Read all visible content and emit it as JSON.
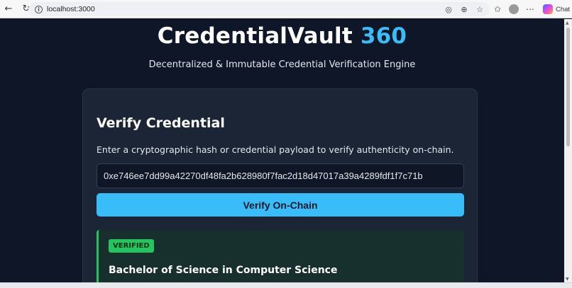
{
  "browser": {
    "url": "localhost:3000",
    "chat_label": "Chat",
    "icons": [
      "back-icon",
      "reload-icon",
      "info-icon",
      "translate-icon",
      "zoom-icon",
      "favorite-icon",
      "collections-icon",
      "profile-avatar",
      "more-icon",
      "copilot-icon"
    ]
  },
  "header": {
    "title_main": "CredentialVault",
    "title_accent": "360",
    "subtitle": "Decentralized & Immutable Credential Verification Engine"
  },
  "verify": {
    "title": "Verify Credential",
    "description": "Enter a cryptographic hash or credential payload to verify authenticity on-chain.",
    "hash_value": "0xe746ee7dd99a42270df48fa2b628980f7fac2d18d47017a39a4289fdf1f7c71b",
    "button_label": "Verify On-Chain"
  },
  "result": {
    "badge": "VERIFIED",
    "title": "Bachelor of Science in Computer Science"
  },
  "colors": {
    "background": "#0e1627",
    "card": "#1b2535",
    "accent": "#38bdf8",
    "success": "#22c55e"
  }
}
